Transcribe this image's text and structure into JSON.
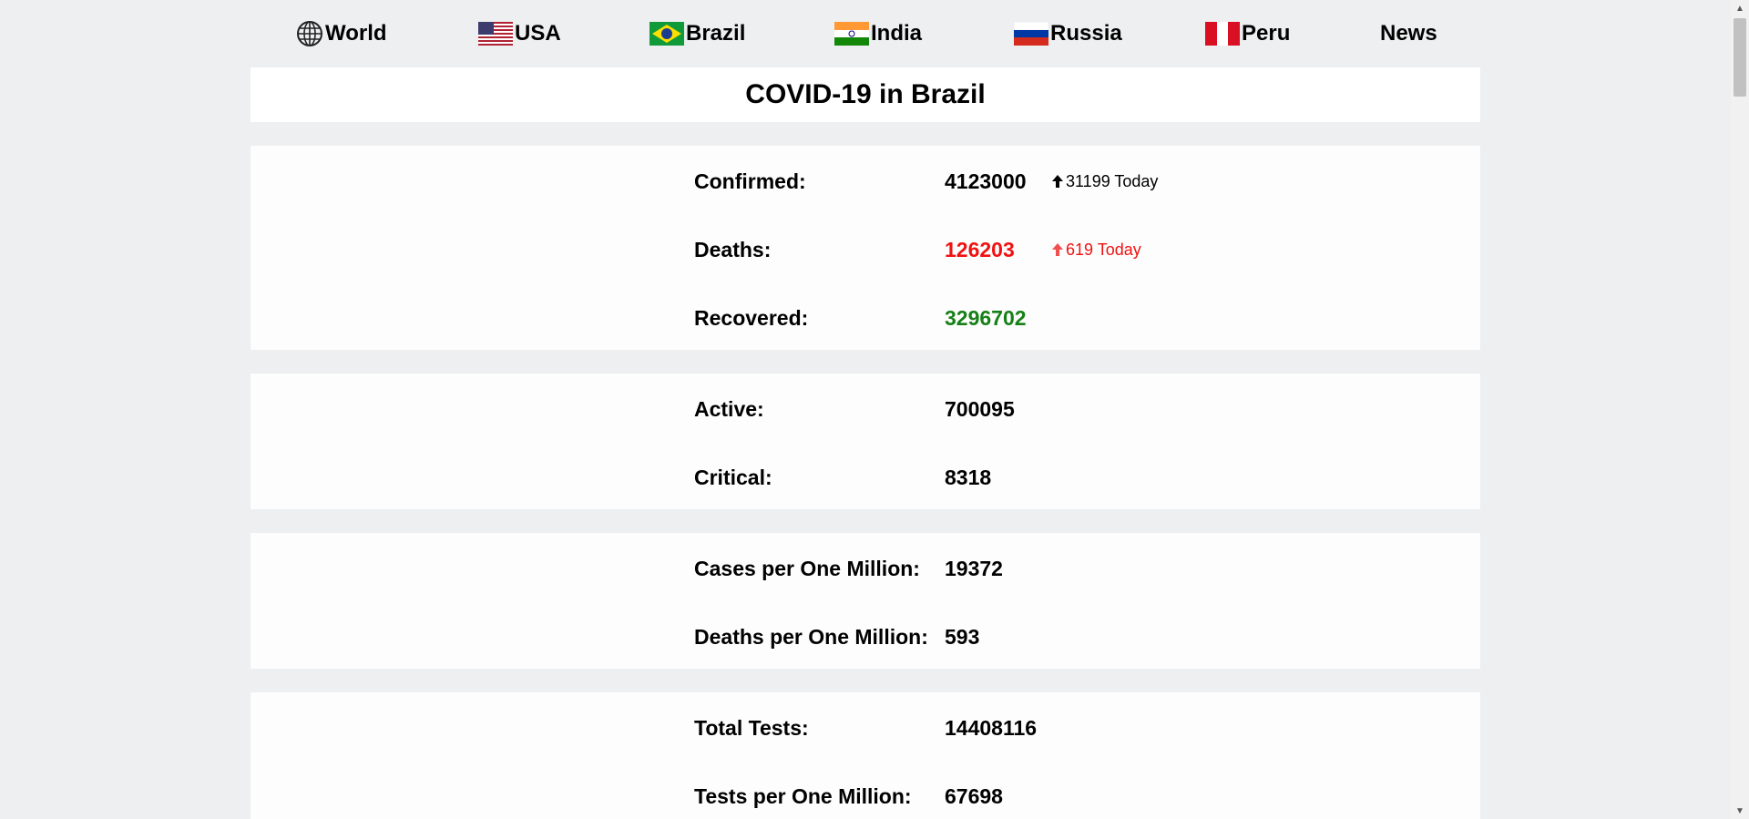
{
  "nav": {
    "world": "World",
    "usa": "USA",
    "brazil": "Brazil",
    "india": "India",
    "russia": "Russia",
    "peru": "Peru",
    "news": "News"
  },
  "title": "COVID-19 in Brazil",
  "stats": {
    "confirmed": {
      "label": "Confirmed:",
      "value": "4123000",
      "today": "31199 Today"
    },
    "deaths": {
      "label": "Deaths:",
      "value": "126203",
      "today": "619 Today"
    },
    "recovered": {
      "label": "Recovered:",
      "value": "3296702"
    },
    "active": {
      "label": "Active:",
      "value": "700095"
    },
    "critical": {
      "label": "Critical:",
      "value": "8318"
    },
    "cases_per_million": {
      "label": "Cases per One Million:",
      "value": "19372"
    },
    "deaths_per_million": {
      "label": "Deaths per One Million:",
      "value": "593"
    },
    "total_tests": {
      "label": "Total Tests:",
      "value": "14408116"
    },
    "tests_per_million": {
      "label": "Tests per One Million:",
      "value": "67698"
    }
  },
  "colors": {
    "background": "#edeff0",
    "card": "#fcfdfc",
    "deaths": "#f01212",
    "recovered": "#168016"
  },
  "icons": {
    "world": "globe-icon",
    "up_arrow": "arrow-up-icon",
    "scroll_up": "scroll-up-arrow",
    "scroll_down": "scroll-down-arrow"
  }
}
